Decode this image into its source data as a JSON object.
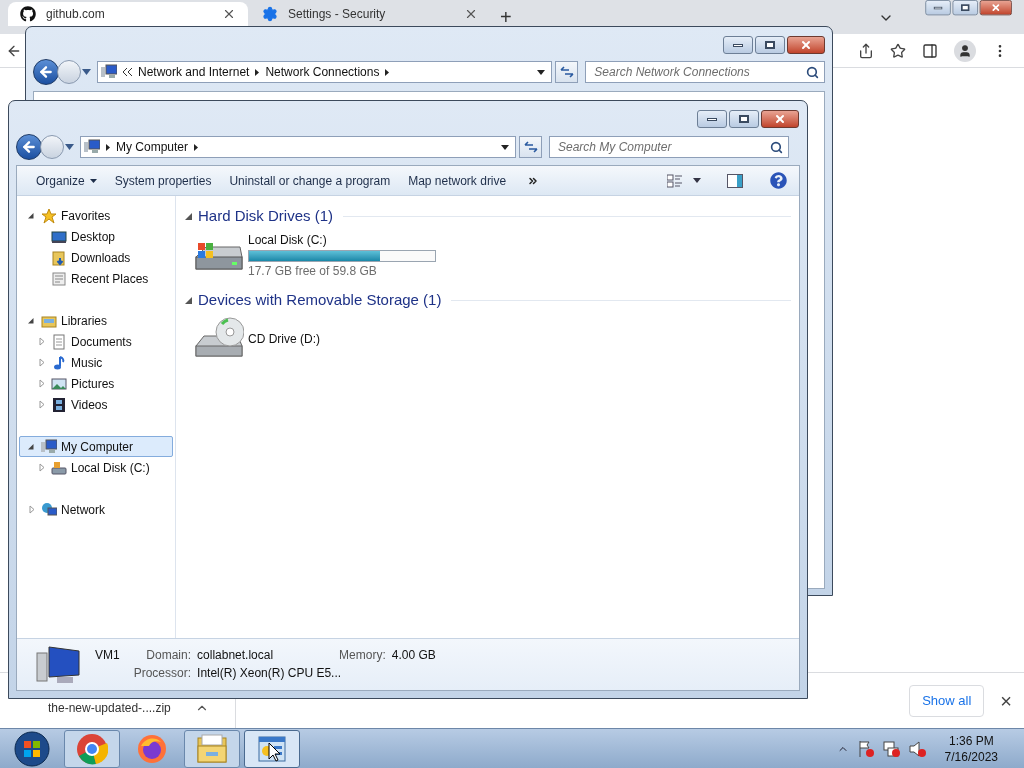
{
  "browser": {
    "tabs": [
      {
        "kind": "github",
        "title": "github.com",
        "selected": true
      },
      {
        "kind": "settings",
        "title": "Settings - Security",
        "selected": false
      }
    ],
    "new_tab": "+",
    "download": {
      "file": "the-new-updated-....zip",
      "show_all": "Show all",
      "close": "×"
    }
  },
  "back_window": {
    "breadcrumb": [
      "Network and Internet",
      "Network Connections"
    ],
    "search": {
      "placeholder": "Search Network Connections"
    }
  },
  "window": {
    "breadcrumb": [
      "My Computer"
    ],
    "search": {
      "placeholder": "Search My Computer"
    },
    "toolbar": [
      {
        "label": "Organize",
        "menu": true
      },
      {
        "label": "System properties",
        "menu": false
      },
      {
        "label": "Uninstall or change a program",
        "menu": false
      },
      {
        "label": "Map network drive",
        "menu": false
      }
    ],
    "sidebar": [
      {
        "kind": "star",
        "label": "Favorites",
        "selected": false,
        "expanded": true,
        "children": [
          {
            "kind": "desktop",
            "label": "Desktop",
            "selected": false
          },
          {
            "kind": "downloads",
            "label": "Downloads",
            "selected": false
          },
          {
            "kind": "recent",
            "label": "Recent Places",
            "selected": false
          }
        ]
      },
      {
        "kind": "library",
        "label": "Libraries",
        "selected": false,
        "expanded": true,
        "children": [
          {
            "kind": "documents",
            "label": "Documents",
            "selected": false,
            "expanded": false
          },
          {
            "kind": "music",
            "label": "Music",
            "selected": false,
            "expanded": false
          },
          {
            "kind": "pictures",
            "label": "Pictures",
            "selected": false,
            "expanded": false
          },
          {
            "kind": "videos",
            "label": "Videos",
            "selected": false,
            "expanded": false
          }
        ]
      },
      {
        "kind": "computer",
        "label": "My Computer",
        "selected": true,
        "expanded": true,
        "children": [
          {
            "kind": "disk",
            "label": "Local Disk (C:)",
            "selected": false,
            "expanded": false
          }
        ]
      },
      {
        "kind": "network",
        "label": "Network",
        "selected": false,
        "expanded": false
      }
    ],
    "groups": [
      {
        "title": "Hard Disk Drives (1)",
        "expanded": true,
        "items": [
          {
            "kind": "disk",
            "name": "Local Disk (C:)",
            "level": 0.704,
            "space": "17.7 GB free of 59.8 GB"
          }
        ]
      },
      {
        "title": "Devices with Removable Storage (1)",
        "expanded": true,
        "items": [
          {
            "kind": "cd",
            "name": "CD Drive (D:)"
          }
        ]
      }
    ],
    "details": {
      "name": "VM1",
      "fields": [
        {
          "label": "Domain:",
          "value": "collabnet.local"
        },
        {
          "label": "Memory:",
          "value": "4.00 GB"
        },
        {
          "label": "Processor:",
          "value": "Intel(R) Xeon(R) CPU E5..."
        }
      ]
    }
  },
  "taskbar": {
    "apps": [
      {
        "kind": "chrome",
        "open": true,
        "selected": false
      },
      {
        "kind": "firefox",
        "open": false,
        "selected": false
      },
      {
        "kind": "explorer",
        "open": true,
        "selected": false
      },
      {
        "kind": "control-panel",
        "open": true,
        "selected": true
      }
    ],
    "clock": {
      "time": "1:36 PM",
      "date": "7/16/2023"
    }
  }
}
